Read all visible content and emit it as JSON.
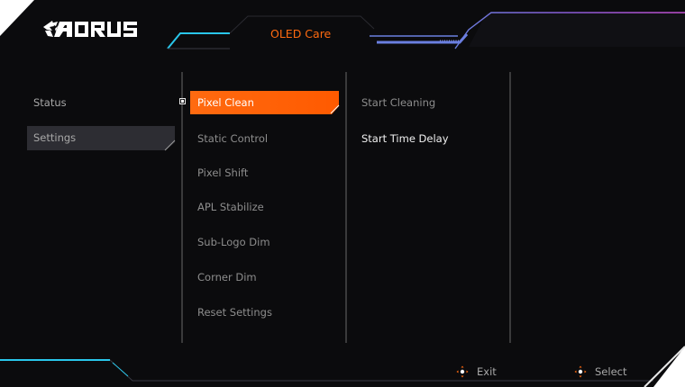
{
  "brand": {
    "logo_text": "AORUS"
  },
  "header": {
    "title": "OLED Care"
  },
  "left_menu": {
    "items": [
      {
        "label": "Status",
        "selected": false
      },
      {
        "label": "Settings",
        "selected": true
      }
    ]
  },
  "mid_menu": {
    "items": [
      {
        "label": "Pixel Clean",
        "selected": true
      },
      {
        "label": "Static Control",
        "selected": false
      },
      {
        "label": "Pixel Shift",
        "selected": false
      },
      {
        "label": "APL Stabilize",
        "selected": false
      },
      {
        "label": "Sub-Logo Dim",
        "selected": false
      },
      {
        "label": "Corner Dim",
        "selected": false
      },
      {
        "label": "Reset Settings",
        "selected": false
      }
    ]
  },
  "options": {
    "items": [
      {
        "label": "Start Cleaning",
        "active": false
      },
      {
        "label": "Start Time Delay",
        "active": true
      }
    ]
  },
  "footer": {
    "exit_label": "Exit",
    "select_label": "Select",
    "exit_icon": "joystick-icon",
    "select_icon": "joystick-icon"
  },
  "colors": {
    "background": "#0b0b0d",
    "accent": "#ff6a10",
    "cyan": "#29c6ea",
    "purple": "#a45ad8",
    "divider": "#5a5a5a"
  }
}
